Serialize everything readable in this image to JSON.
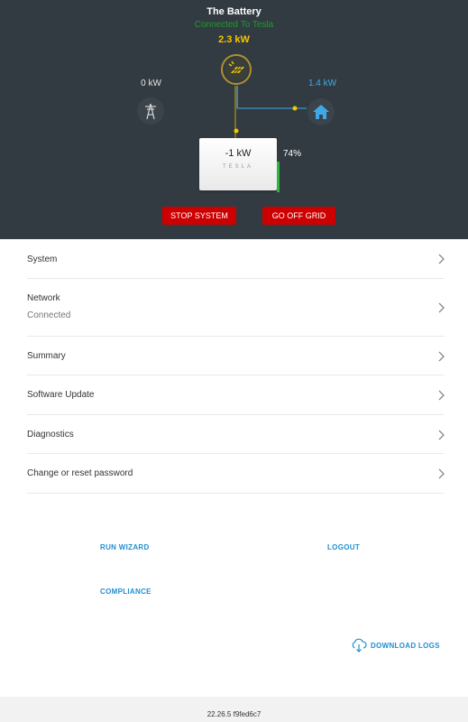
{
  "header": {
    "title": "The Battery",
    "connection_status": "Connected To Tesla",
    "solar_power": "2.3 kW",
    "grid_power": "0 kW",
    "home_power": "1.4 kW",
    "battery": {
      "power": "-1 kW",
      "brand": "TESLA",
      "charge_percent": "74%",
      "charge_fraction": 0.74
    },
    "colors": {
      "background": "#323b42",
      "solar": "#f5c500",
      "home": "#3fa9e8",
      "connected": "#1f9a2e",
      "battery_fill": "#2db83d",
      "action_button": "#cc0000"
    },
    "icons": {
      "solar": "solar-panel-icon",
      "grid": "power-tower-icon",
      "home": "house-icon"
    },
    "buttons": {
      "stop_system": "STOP SYSTEM",
      "go_off_grid": "GO OFF GRID"
    }
  },
  "menu": {
    "items": [
      {
        "label": "System",
        "sub": ""
      },
      {
        "label": "Network",
        "sub": "Connected"
      },
      {
        "label": "Summary",
        "sub": ""
      },
      {
        "label": "Software Update",
        "sub": ""
      },
      {
        "label": "Diagnostics",
        "sub": ""
      },
      {
        "label": "Change or reset password",
        "sub": ""
      }
    ]
  },
  "actions": {
    "run_wizard": "RUN WIZARD",
    "logout": "LOGOUT",
    "compliance": "COMPLIANCE",
    "download_logs": "DOWNLOAD LOGS"
  },
  "footer": {
    "version": "22.26.5 f9fed6c7"
  }
}
